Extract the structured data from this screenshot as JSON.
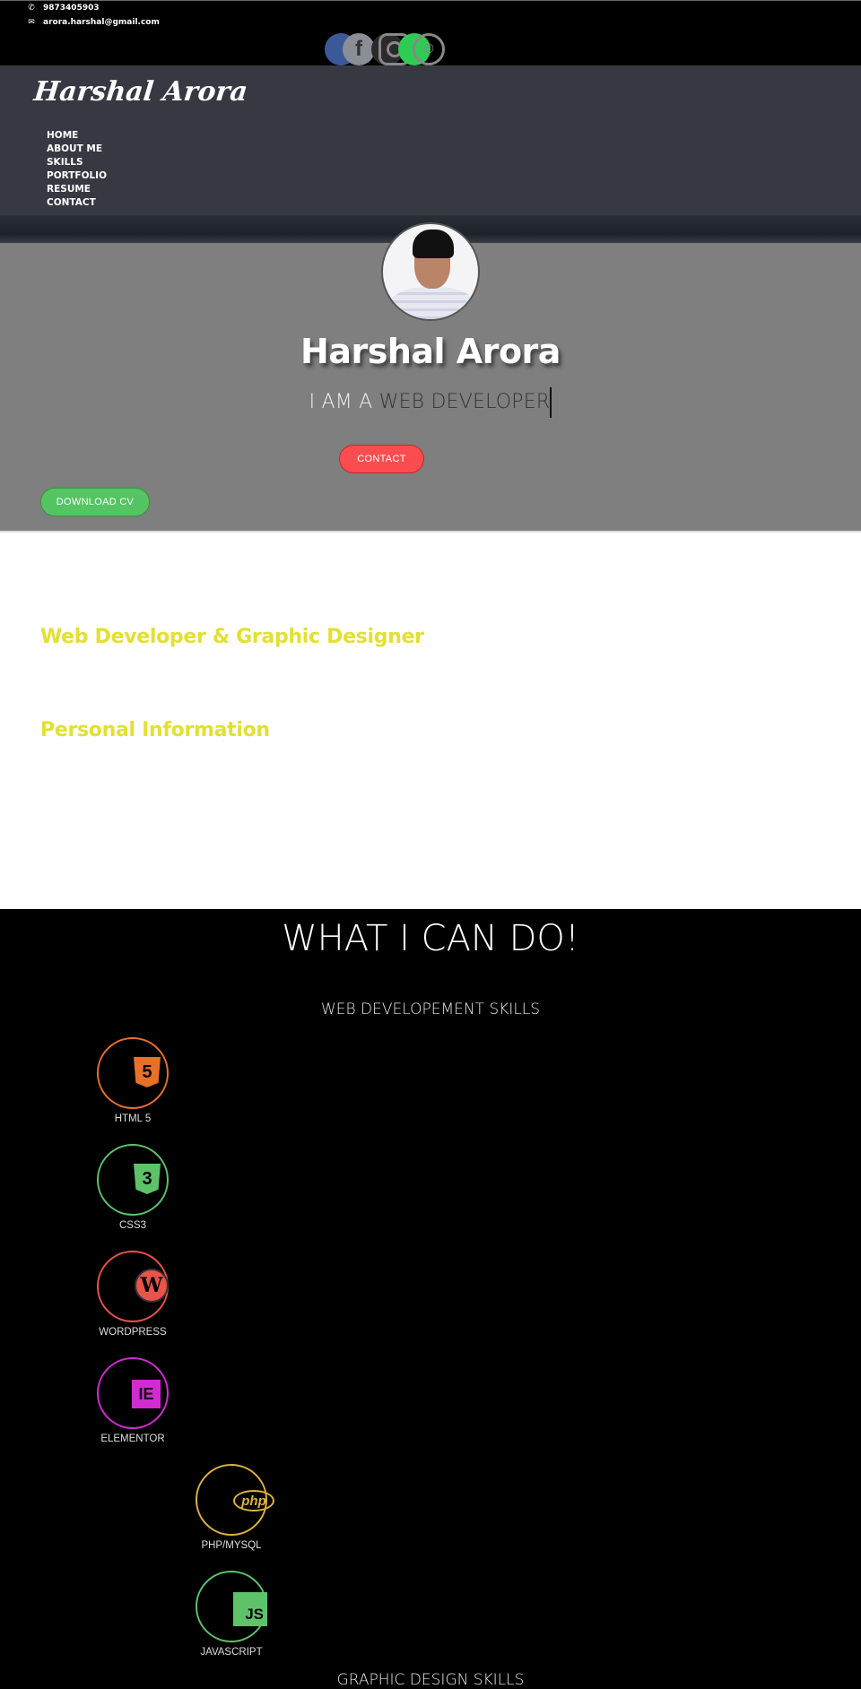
{
  "topbar": {
    "phone": "9873405903",
    "email": "arora.harshal@gmail.com",
    "phone_icon": "phone-icon",
    "email_icon": "envelope-icon",
    "socials": [
      {
        "name": "facebook",
        "icon": "facebook-icon",
        "glyph": "f",
        "color": "#3b5998"
      },
      {
        "name": "instagram",
        "icon": "instagram-icon",
        "color": "#2a2a2a"
      },
      {
        "name": "whatsapp",
        "icon": "whatsapp-icon",
        "glyph": "✆",
        "color": "#2ecc55"
      }
    ]
  },
  "header": {
    "logo": "Harshal Arora",
    "nav": [
      "HOME",
      "ABOUT ME",
      "SKILLS",
      "PORTFOLIO",
      "RESUME",
      "CONTACT"
    ]
  },
  "hero": {
    "name": "Harshal Arora",
    "tagline_prefix": "I AM A ",
    "tagline_role": "WEB DEVELOPER",
    "contact_button": "CONTACT",
    "download_button": "DOWNLOAD CV",
    "colors": {
      "contact": "#fb4c4f",
      "download": "#55c563"
    }
  },
  "about": {
    "role_heading": "Web Developer & Graphic Designer",
    "info_heading": "Personal Information",
    "accent": "#e2e033"
  },
  "skills": {
    "title": "WHAT I CAN DO!",
    "web_subtitle": "WEB DEVELOPEMENT SKILLS",
    "graphic_subtitle": "GRAPHIC DESIGN SKILLS",
    "web": [
      {
        "label": "HTML 5",
        "icon": "html5-icon",
        "glyph": "5",
        "color": "#e8702a"
      },
      {
        "label": "CSS3",
        "icon": "css3-icon",
        "glyph": "3",
        "color": "#5ec26b"
      },
      {
        "label": "WORDPRESS",
        "icon": "wordpress-icon",
        "glyph": "W",
        "color": "#e8534a"
      },
      {
        "label": "ELEMENTOR",
        "icon": "elementor-icon",
        "glyph": "IE",
        "color": "#d22bd2"
      },
      {
        "label": "PHP/MYSQL",
        "icon": "php-icon",
        "glyph": "php",
        "color": "#dbb240"
      },
      {
        "label": "JAVASCRIPT",
        "icon": "javascript-icon",
        "glyph": "JS",
        "color": "#5ec26b"
      }
    ]
  }
}
